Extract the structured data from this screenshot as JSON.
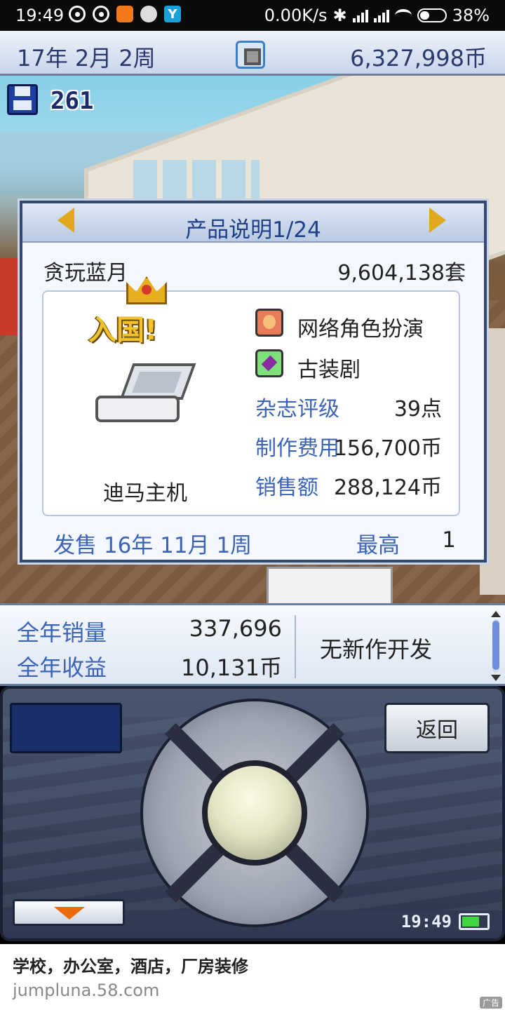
{
  "status_bar": {
    "time": "19:49",
    "network_speed": "0.00K/s",
    "battery": "38%",
    "battery_level": 0.38
  },
  "top_bar": {
    "date": "17年 2月 2周",
    "money": "6,327,998币"
  },
  "scene": {
    "save_count": "261"
  },
  "product": {
    "header": "产品说明1/24",
    "name": "贪玩蓝月",
    "units_sold": "9,604,138套",
    "badge": "入国!",
    "platform": "迪马主机",
    "genre_1": "网络角色扮演",
    "genre_2": "古装剧",
    "stats": [
      {
        "label": "杂志评级",
        "value": "39点"
      },
      {
        "label": "制作费用",
        "value": "156,700币"
      },
      {
        "label": "销售额",
        "value": "288,124币"
      }
    ],
    "release": "发售 16年 11月 1周",
    "best_label": "最高",
    "best_value": "1"
  },
  "annual": {
    "sales_label": "全年销量",
    "sales_value": "337,696",
    "revenue_label": "全年收益",
    "revenue_value": "10,131币",
    "news": "无新作开发"
  },
  "controller": {
    "back_label": "返回",
    "clock": "19:49",
    "battery_level": 0.7
  },
  "ad": {
    "title": "学校，办公室，酒店，厂房装修",
    "url": "jumpluna.58.com",
    "tag": "广告"
  },
  "icons": {
    "save": "floppy-disk-icon",
    "camera": "camera-icon",
    "prev": "arrow-left-icon",
    "next": "arrow-right-icon",
    "genre_1": "face-icon",
    "genre_2": "gem-icon",
    "menu": "arrow-down-icon"
  },
  "colors": {
    "accent_blue": "#3b63b8",
    "arrow_gold": "#e1a81e",
    "menu_orange": "#ea6a10",
    "battery_green": "#3fd63f"
  }
}
